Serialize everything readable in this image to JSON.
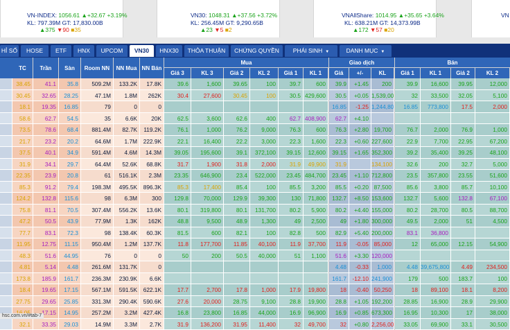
{
  "indices": [
    {
      "name": "VN-INDEX:",
      "value": "1056.61",
      "arrow": "▲",
      "change": "+32.67",
      "pct": "+3.19%",
      "kl_label": "KL:",
      "kl": "797.39M",
      "gt_label": "GT:",
      "gt": "17,830.00B",
      "up": "▲375",
      "down": "▼90",
      "ref": "■35"
    },
    {
      "name": "VN30:",
      "value": "1048.31",
      "arrow": "▲",
      "change": "+37.56",
      "pct": "+3.72%",
      "kl_label": "KL:",
      "kl": "256.45M",
      "gt_label": "GT:",
      "gt": "9,290.65B",
      "up": "▲23",
      "down": "▼5",
      "ref": "■2"
    },
    {
      "name": "VNAllShare:",
      "value": "1014.95",
      "arrow": "▲",
      "change": "+35.65",
      "pct": "+3.64%",
      "kl_label": "KL:",
      "kl": "638.21M",
      "gt_label": "GT:",
      "gt": "14,373.99B",
      "up": "▲172",
      "down": "▼57",
      "ref": "■20"
    }
  ],
  "right_edge_index": "VN",
  "tabs": [
    {
      "label": "HỈ SỐ"
    },
    {
      "label": "HOSE"
    },
    {
      "label": "ETF"
    },
    {
      "label": "HNX"
    },
    {
      "label": "UPCOM"
    },
    {
      "label": "VN30",
      "active": true
    },
    {
      "label": "HNX30"
    },
    {
      "label": "THỎA THUẬN"
    },
    {
      "label": "CHỨNG QUYỀN"
    },
    {
      "label": "PHÁI SINH",
      "caret": true
    },
    {
      "label": "DANH MỤC",
      "caret": true
    }
  ],
  "headers": {
    "tc": "TC",
    "tran": "Trần",
    "san": "Sàn",
    "room": "Room NN",
    "nn_mua": "NN Mua",
    "nn_ban": "NN Bán",
    "mua": "Mua",
    "giao_dich": "Giao dịch",
    "ban": "Bán",
    "sub": [
      "Giá 3",
      "KL 3",
      "Giá 2",
      "KL 2",
      "Giá 1",
      "KL 1",
      "Giá",
      "+/-",
      "KL",
      "Giá 1",
      "KL 1",
      "Giá 2",
      "KL 2"
    ]
  },
  "rows": [
    [
      "38.45",
      "41.1",
      "35.8",
      "509.2M",
      "133.2K",
      "17.8K",
      "39.6",
      "1,600",
      "39.65",
      "100",
      "39.7",
      "600",
      "39.9",
      "+1.45",
      "200",
      "39.9",
      "16,600",
      "39.95",
      "12,000"
    ],
    [
      "30.45",
      "32.65",
      "28.25",
      "47.1M",
      "1.8M",
      "262K",
      "30.4",
      "27,600",
      "30.45",
      "100",
      "30.5",
      "429,600",
      "30.5",
      "+0.05",
      "1,539,000",
      "32",
      "33,500",
      "32.05",
      "5,100"
    ],
    [
      "18.1",
      "19.35",
      "16.85",
      "79",
      "0",
      "0",
      "",
      "",
      "",
      "",
      "",
      "",
      "16.85",
      "-1.25",
      "1,244,800",
      "16.85",
      "773,800",
      "17.5",
      "2,000"
    ],
    [
      "58.6",
      "62.7",
      "54.5",
      "35",
      "6.6K",
      "20K",
      "62.5",
      "3,600",
      "62.6",
      "400",
      "62.7",
      "408,900",
      "62.7",
      "+4.10",
      "",
      "",
      "",
      "",
      ""
    ],
    [
      "73.5",
      "78.6",
      "68.4",
      "881.4M",
      "82.7K",
      "119.2K",
      "76.1",
      "1,000",
      "76.2",
      "9,000",
      "76.3",
      "600",
      "76.3",
      "+2.80",
      "19,700",
      "76.7",
      "2,000",
      "76.9",
      "1,000"
    ],
    [
      "21.7",
      "23.2",
      "20.2",
      "64.6M",
      "1.7M",
      "222.9K",
      "22.1",
      "16,400",
      "22.2",
      "3,000",
      "22.3",
      "1,600",
      "22.3",
      "+0.60",
      "227,600",
      "22.9",
      "7,700",
      "22.95",
      "67,200"
    ],
    [
      "37.5",
      "40.1",
      "34.9",
      "591.4M",
      "4.6M",
      "14.3M",
      "39.05",
      "195,600",
      "39.1",
      "372,100",
      "39.15",
      "12,600",
      "39.15",
      "+1.65",
      "352,300",
      "39.2",
      "35,400",
      "39.25",
      "48,100"
    ],
    [
      "31.9",
      "34.1",
      "29.7",
      "64.4M",
      "52.6K",
      "68.8K",
      "31.7",
      "1,900",
      "31.8",
      "2,000",
      "31.9",
      "49,900",
      "31.9",
      "",
      "134,100",
      "32.6",
      "200",
      "32.7",
      "5,000"
    ],
    [
      "22.35",
      "23.9",
      "20.8",
      "61",
      "516.1K",
      "2.3M",
      "23.35",
      "646,900",
      "23.4",
      "522,000",
      "23.45",
      "484,700",
      "23.45",
      "+1.10",
      "712,800",
      "23.5",
      "357,800",
      "23.55",
      "51,600"
    ],
    [
      "85.3",
      "91.2",
      "79.4",
      "198.3M",
      "495.5K",
      "896.3K",
      "85.3",
      "17,400",
      "85.4",
      "100",
      "85.5",
      "3,200",
      "85.5",
      "+0.20",
      "87,500",
      "85.6",
      "3,800",
      "85.7",
      "10,100"
    ],
    [
      "124.2",
      "132.8",
      "115.6",
      "98",
      "6.3M",
      "300",
      "129.8",
      "70,000",
      "129.9",
      "39,300",
      "130",
      "71,800",
      "132.7",
      "+8.50",
      "153,600",
      "132.7",
      "5,600",
      "132.8",
      "67,100"
    ],
    [
      "75.8",
      "81.1",
      "70.5",
      "307.4M",
      "556.2K",
      "13.6K",
      "80.1",
      "319,800",
      "80.1",
      "131,700",
      "80.2",
      "5,900",
      "80.2",
      "+4.40",
      "155,000",
      "80.2",
      "28,700",
      "80.5",
      "88,700"
    ],
    [
      "47.2",
      "50.5",
      "43.9",
      "77.9M",
      "1.3K",
      "162K",
      "48.8",
      "9,500",
      "48.9",
      "1,300",
      "49",
      "2,500",
      "49",
      "+1.80",
      "300,000",
      "49.5",
      "2,000",
      "51",
      "4,500"
    ],
    [
      "77.7",
      "83.1",
      "72.3",
      "98",
      "138.4K",
      "60.3K",
      "81.5",
      "600",
      "82.1",
      "100",
      "82.8",
      "500",
      "82.9",
      "+5.40",
      "200,000",
      "83.1",
      "36,800",
      "",
      ""
    ],
    [
      "11.95",
      "12.75",
      "11.15",
      "950.4M",
      "1.2M",
      "137.7K",
      "11.8",
      "177,700",
      "11.85",
      "40,100",
      "11.9",
      "37,700",
      "11.9",
      "-0.05",
      "85,000",
      "12",
      "65,000",
      "12.15",
      "54,900"
    ],
    [
      "48.3",
      "51.6",
      "44.95",
      "76",
      "0",
      "0",
      "50",
      "200",
      "50.5",
      "40,000",
      "51",
      "1,100",
      "51.6",
      "+3.30",
      "120,000",
      "",
      "",
      "",
      ""
    ],
    [
      "4.81",
      "5.14",
      "4.48",
      "261.6M",
      "131.7K",
      "0",
      "",
      "",
      "",
      "",
      "",
      "",
      "4.48",
      "-0.33",
      "1,000",
      "4.48",
      "39,675,800",
      "4.49",
      "234,500"
    ],
    [
      "173.8",
      "185.9",
      "161.7",
      "236.3M",
      "230.9K",
      "6.6K",
      "",
      "",
      "",
      "",
      "",
      "",
      "161.7",
      "-12.10",
      "241,900",
      "179",
      "500",
      "183.7",
      "100"
    ],
    [
      "18.4",
      "19.65",
      "17.15",
      "567.1M",
      "591.5K",
      "622.1K",
      "17.7",
      "2,700",
      "17.8",
      "1,000",
      "17.9",
      "19,800",
      "18",
      "-0.40",
      "50,250",
      "18",
      "89,100",
      "18.1",
      "8,200"
    ],
    [
      "27.75",
      "29.65",
      "25.85",
      "331.3M",
      "290.4K",
      "590.6K",
      "27.6",
      "20,000",
      "28.75",
      "9,100",
      "28.8",
      "19,900",
      "28.8",
      "+1.05",
      "192,200",
      "28.85",
      "16,900",
      "28.9",
      "29,900"
    ],
    [
      "16.05",
      "17.15",
      "14.95",
      "257.2M",
      "3.2M",
      "427.4K",
      "16.8",
      "23,800",
      "16.85",
      "44,000",
      "16.9",
      "96,900",
      "16.9",
      "+0.85",
      "673,300",
      "16.95",
      "10,300",
      "17",
      "38,000"
    ],
    [
      "32.1",
      "33.35",
      "29.03",
      "14.9M",
      "3.3M",
      "2.7K",
      "31.9",
      "136,200",
      "31.95",
      "11,400",
      "32",
      "49,700",
      "32",
      "+0.80",
      "2,256,000",
      "33.05",
      "69,900",
      "33.1",
      "30,500"
    ]
  ],
  "status_url": "hsc.com.vn/#tab-7",
  "colors": {
    "ref": "#d9a300",
    "ceil": "#a61cbf",
    "floor": "#1a8fd6",
    "up": "#1aa31a",
    "down": "#e0201c"
  }
}
